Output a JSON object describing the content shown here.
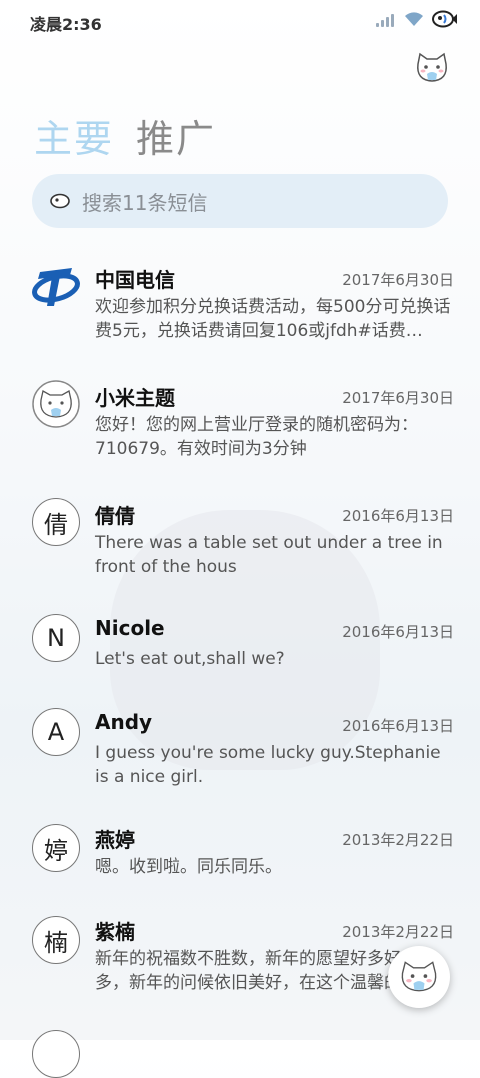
{
  "status": {
    "time": "凌晨2:36"
  },
  "tabs": [
    {
      "label": "主要"
    },
    {
      "label": "推广"
    }
  ],
  "search": {
    "placeholder": "搜索11条短信"
  },
  "conversations": [
    {
      "avatar": "",
      "name": "中国电信",
      "date": "2017年6月30日",
      "message": "欢迎参加积分兑换话费活动，每500分可兑换话费5元，兑换话费请回复106或jfdh#话费…"
    },
    {
      "avatar": "",
      "name": "小米主题",
      "date": "2017年6月30日",
      "message": "您好！您的网上营业厅登录的随机密码为：710679。有效时间为3分钟"
    },
    {
      "avatar": "倩",
      "name": "倩倩",
      "date": "2016年6月13日",
      "message": "There was a table set out under a tree in front of the hous"
    },
    {
      "avatar": "N",
      "name": "Nicole",
      "date": "2016年6月13日",
      "message": "Let's eat out,shall we?"
    },
    {
      "avatar": "A",
      "name": "Andy",
      "date": "2016年6月13日",
      "message": "I guess you're some lucky guy.Stephanie is a nice girl."
    },
    {
      "avatar": "婷",
      "name": "燕婷",
      "date": "2013年2月22日",
      "message": "嗯。收到啦。同乐同乐。"
    },
    {
      "avatar": "楠",
      "name": "紫楠",
      "date": "2013年2月22日",
      "message": "新年的祝福数不胜数，新年的愿望好多好多，新年的问候依旧美好，在这个温馨的时"
    }
  ],
  "colors": {
    "tab_active": "#aed6f0",
    "search_bg": "#e3eef7",
    "telecom_blue": "#1a5fb4"
  }
}
